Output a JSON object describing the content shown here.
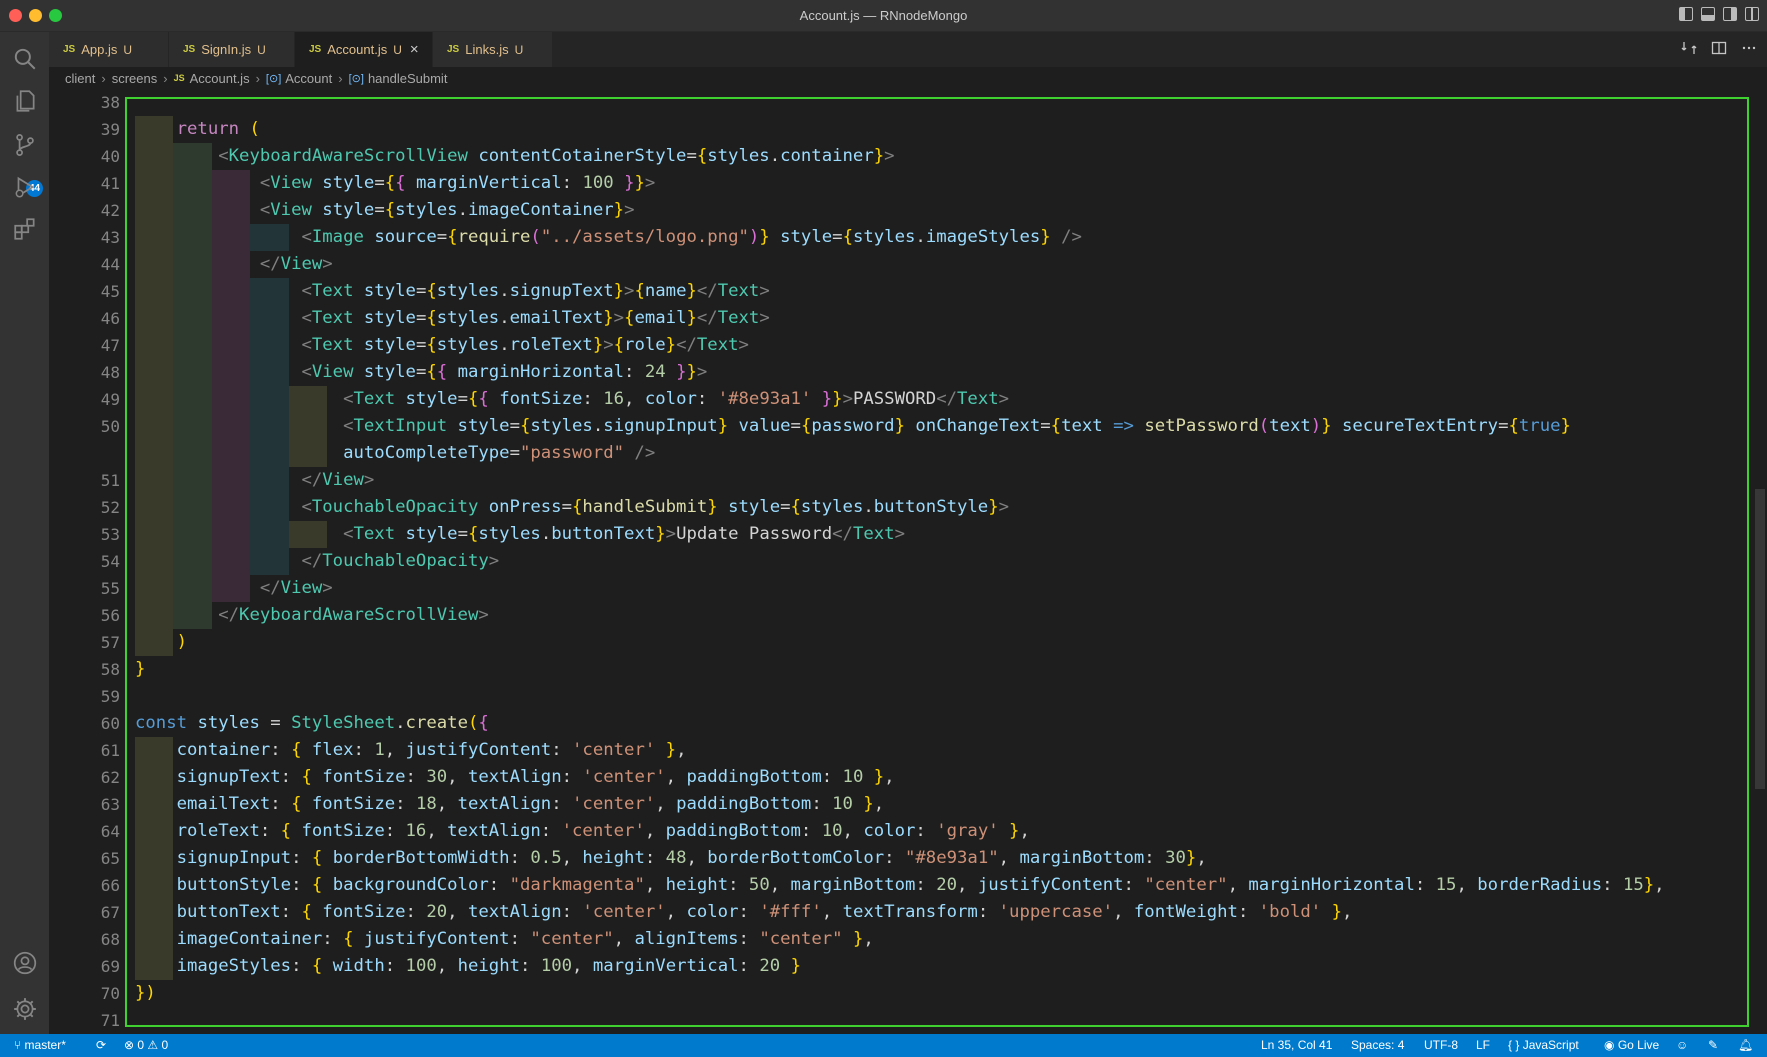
{
  "window": {
    "title": "Account.js — RNnodeMongo"
  },
  "activity_bar": {
    "items": [
      {
        "name": "search-icon"
      },
      {
        "name": "explorer-icon"
      },
      {
        "name": "source-control-icon",
        "badge": "44"
      },
      {
        "name": "run-debug-icon"
      },
      {
        "name": "extensions-icon"
      },
      {
        "name": "account-icon"
      },
      {
        "name": "settings-gear-icon"
      }
    ]
  },
  "tabs": [
    {
      "label": "App.js",
      "status": "U",
      "file_type": "JS",
      "active": false
    },
    {
      "label": "SignIn.js",
      "status": "U",
      "file_type": "JS",
      "active": false
    },
    {
      "label": "Account.js",
      "status": "U",
      "file_type": "JS",
      "active": true,
      "close": "×"
    },
    {
      "label": "Links.js",
      "status": "U",
      "file_type": "JS",
      "active": false
    }
  ],
  "breadcrumb": {
    "items": [
      "client",
      "screens",
      "Account.js",
      "Account",
      "handleSubmit"
    ],
    "file_type": "JS"
  },
  "editor": {
    "lines": [
      {
        "n": "38",
        "code": ""
      },
      {
        "n": "39",
        "code": "    return ("
      },
      {
        "n": "40",
        "code": "        <KeyboardAwareScrollView contentCotainerStyle={styles.container}>"
      },
      {
        "n": "41",
        "code": "            <View style={{ marginVertical: 100 }}>"
      },
      {
        "n": "42",
        "code": "            <View style={styles.imageContainer}>"
      },
      {
        "n": "43",
        "code": "                <Image source={require(\"../assets/logo.png\")} style={styles.imageStyles} />"
      },
      {
        "n": "44",
        "code": "            </View>"
      },
      {
        "n": "45",
        "code": "                <Text style={styles.signupText}>{name}</Text>"
      },
      {
        "n": "46",
        "code": "                <Text style={styles.emailText}>{email}</Text>"
      },
      {
        "n": "47",
        "code": "                <Text style={styles.roleText}>{role}</Text>"
      },
      {
        "n": "48",
        "code": "                <View style={{ marginHorizontal: 24 }}>"
      },
      {
        "n": "49",
        "code": "                    <Text style={{ fontSize: 16, color: '#8e93a1' }}>PASSWORD</Text>"
      },
      {
        "n": "50",
        "code": "                    <TextInput style={styles.signupInput} value={password} onChangeText={text => setPassword(text)} secureTextEntry={true}"
      },
      {
        "n": "",
        "code": "                    autoCompleteType=\"password\" />"
      },
      {
        "n": "51",
        "code": "                </View>"
      },
      {
        "n": "52",
        "code": "                <TouchableOpacity onPress={handleSubmit} style={styles.buttonStyle}>"
      },
      {
        "n": "53",
        "code": "                    <Text style={styles.buttonText}>Update Password</Text>"
      },
      {
        "n": "54",
        "code": "                </TouchableOpacity>"
      },
      {
        "n": "55",
        "code": "            </View>"
      },
      {
        "n": "56",
        "code": "        </KeyboardAwareScrollView>"
      },
      {
        "n": "57",
        "code": "    )"
      },
      {
        "n": "58",
        "code": "}"
      },
      {
        "n": "59",
        "code": ""
      },
      {
        "n": "60",
        "code": "const styles = StyleSheet.create({"
      },
      {
        "n": "61",
        "code": "    container: { flex: 1, justifyContent: 'center' },"
      },
      {
        "n": "62",
        "code": "    signupText: { fontSize: 30, textAlign: 'center', paddingBottom: 10 },"
      },
      {
        "n": "63",
        "code": "    emailText: { fontSize: 18, textAlign: 'center', paddingBottom: 10 },"
      },
      {
        "n": "64",
        "code": "    roleText: { fontSize: 16, textAlign: 'center', paddingBottom: 10, color: 'gray' },"
      },
      {
        "n": "65",
        "code": "    signupInput: { borderBottomWidth: 0.5, height: 48, borderBottomColor: \"#8e93a1\", marginBottom: 30},"
      },
      {
        "n": "66",
        "code": "    buttonStyle: { backgroundColor: \"darkmagenta\", height: 50, marginBottom: 20, justifyContent: \"center\", marginHorizontal: 15, borderRadius: 15},"
      },
      {
        "n": "67",
        "code": "    buttonText: { fontSize: 20, textAlign: 'center', color: '#fff', textTransform: 'uppercase', fontWeight: 'bold' },"
      },
      {
        "n": "68",
        "code": "    imageContainer: { justifyContent: \"center\", alignItems: \"center\" },"
      },
      {
        "n": "69",
        "code": "    imageStyles: { width: 100, height: 100, marginVertical: 20 }"
      },
      {
        "n": "70",
        "code": "})"
      },
      {
        "n": "71",
        "code": ""
      }
    ]
  },
  "status_bar": {
    "branch": "master*",
    "errors": "0",
    "warnings": "0",
    "cursor": "Ln 35, Col 41",
    "spaces": "Spaces: 4",
    "encoding": "UTF-8",
    "eol": "LF",
    "language": "JavaScript",
    "go_live": "Go Live"
  },
  "colors": {
    "status_bar": "#007acc",
    "highlight_box": "#3fd12f",
    "activity_bar": "#333333",
    "editor_bg": "#1e1e1e"
  }
}
